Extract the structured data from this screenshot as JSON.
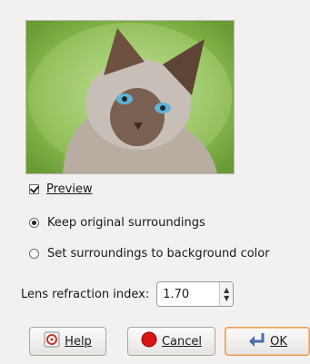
{
  "preview": {
    "image_alt": "cat",
    "checkbox_label": "Preview",
    "checked": true
  },
  "surroundings": {
    "options": [
      {
        "label": "Keep original surroundings",
        "selected": true
      },
      {
        "label": "Set surroundings to background color",
        "selected": false
      }
    ]
  },
  "lens": {
    "label": "Lens refraction index:",
    "value": "1.70"
  },
  "buttons": {
    "help": "Help",
    "cancel": "Cancel",
    "ok": "OK"
  },
  "colors": {
    "ok_border": "#e79b57",
    "cancel_icon": "#d91515"
  }
}
